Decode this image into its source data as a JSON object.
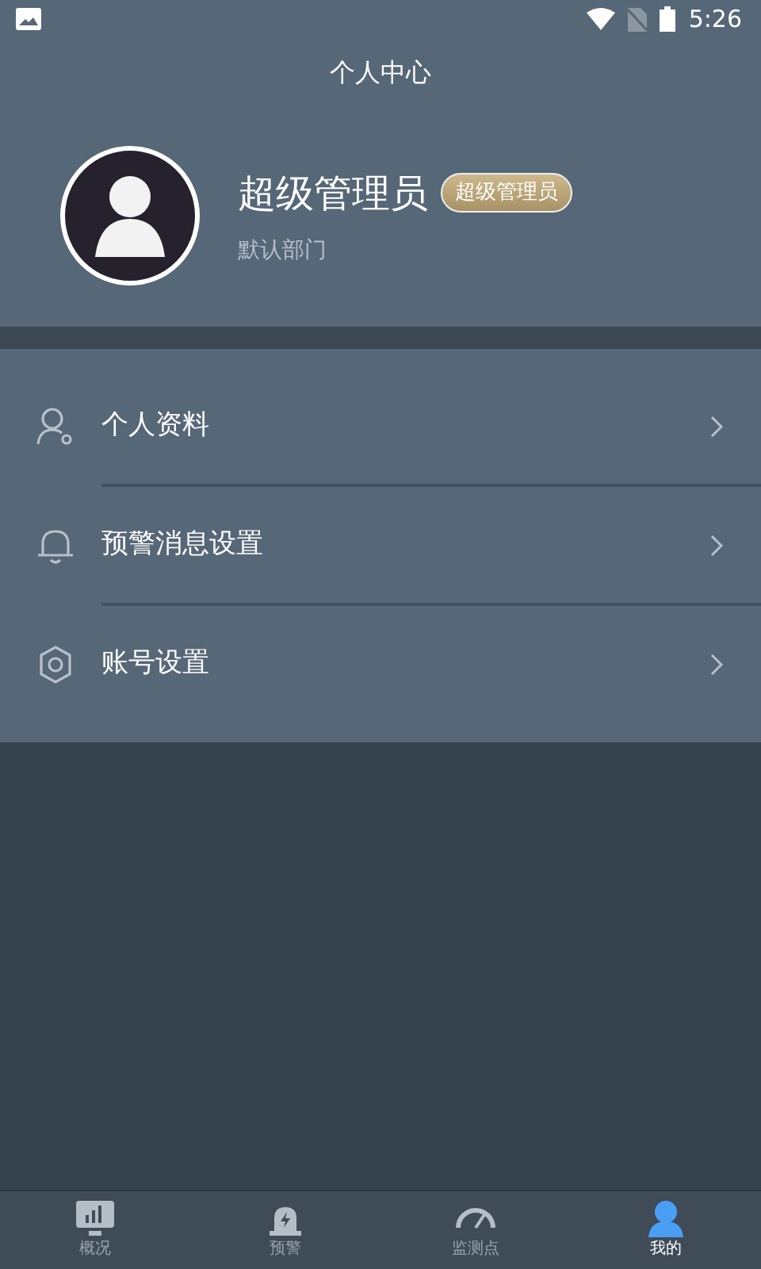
{
  "status_bar": {
    "time": "5:26"
  },
  "header": {
    "title": "个人中心"
  },
  "profile": {
    "name": "超级管理员",
    "role_badge": "超级管理员",
    "department": "默认部门"
  },
  "menu": [
    {
      "kind": "profile",
      "label": "个人资料"
    },
    {
      "kind": "alert",
      "label": "预警消息设置"
    },
    {
      "kind": "account",
      "label": "账号设置"
    }
  ],
  "bottom_nav": [
    {
      "kind": "overview",
      "label": "概况",
      "selected": false
    },
    {
      "kind": "alert",
      "label": "预警",
      "selected": false
    },
    {
      "kind": "monitor",
      "label": "监测点",
      "selected": false
    },
    {
      "kind": "mine",
      "label": "我的",
      "selected": true
    }
  ]
}
